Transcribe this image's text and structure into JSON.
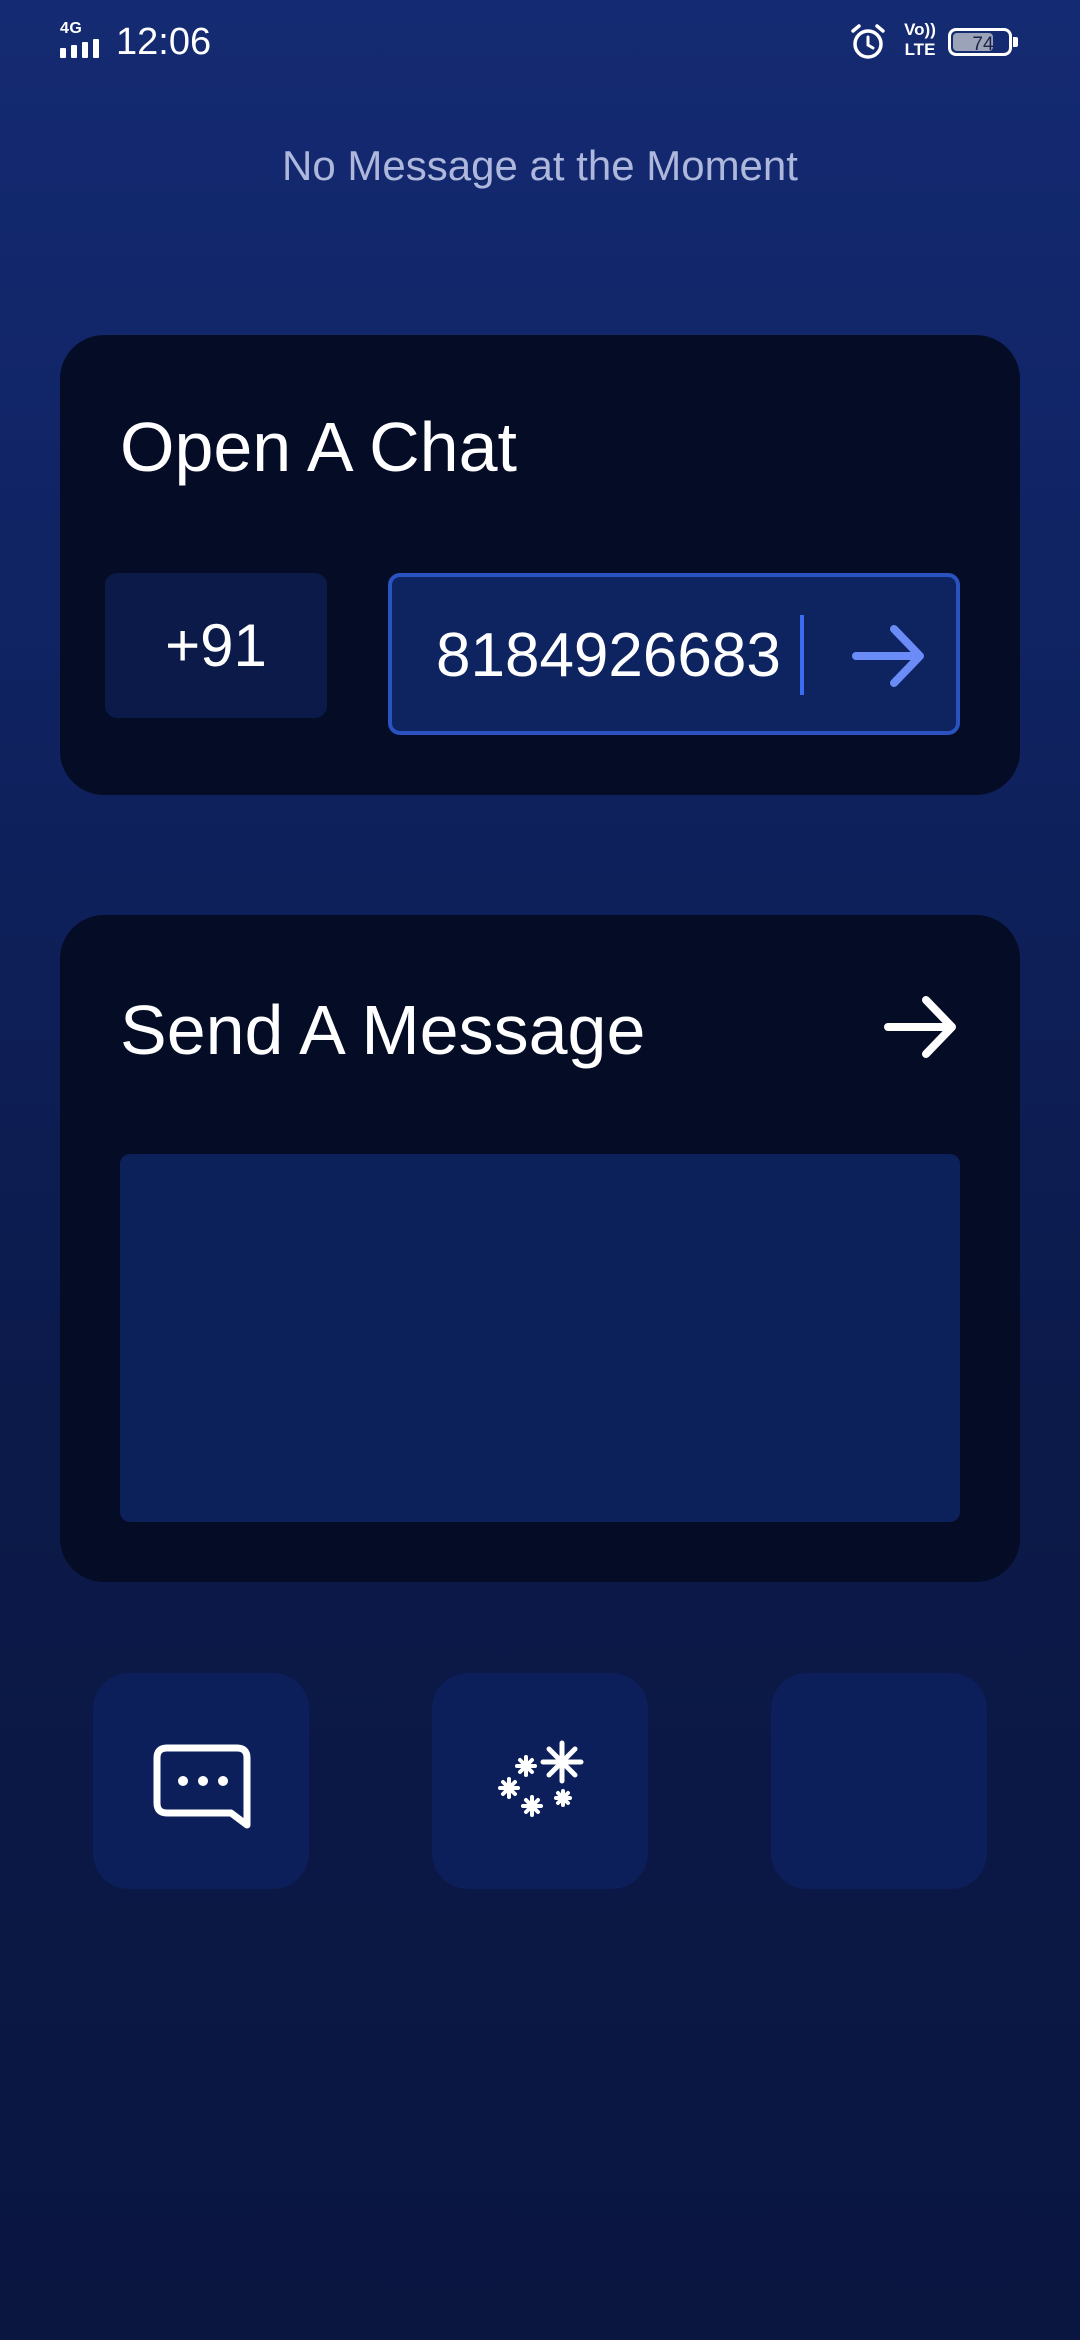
{
  "status_bar": {
    "network": "4G",
    "time": "12:06",
    "volte_top": "Vo))",
    "volte_bottom": "LTE",
    "battery_level": "74",
    "icons": [
      "signal-icon",
      "alarm-icon",
      "volte-icon",
      "battery-icon"
    ]
  },
  "header": {
    "message": "No Message at the Moment"
  },
  "open_chat": {
    "title": "Open A Chat",
    "country_code": "+91",
    "phone_number": "8184926683",
    "go_icon": "arrow-right-icon"
  },
  "send_message": {
    "title": "Send A Message",
    "send_icon": "arrow-right-icon",
    "message_value": ""
  },
  "actions": [
    {
      "icon": "chat-bubble-icon"
    },
    {
      "icon": "sparkle-icon"
    },
    {
      "icon": ""
    }
  ],
  "colors": {
    "background_top": "#142a72",
    "background_bottom": "#0a1640",
    "card": "#050c26",
    "field": "#0e2461",
    "field_border": "#2a52c0",
    "accent_arrow": "#6b8cf7",
    "header_text": "#aeb8dc"
  }
}
